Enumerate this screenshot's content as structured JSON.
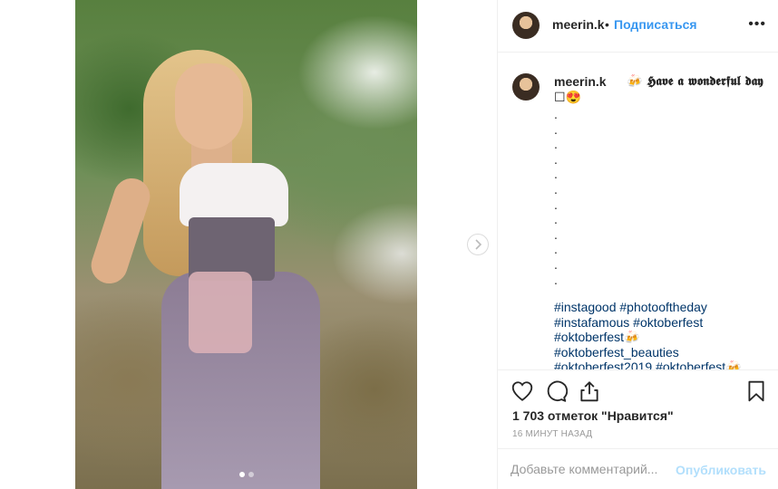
{
  "post": {
    "username": "meerin.k",
    "follow_label": "Подписаться",
    "separator": "•",
    "more_label": "•••",
    "caption_emoji": "🍻",
    "caption_text": "𝕳𝖆𝖛𝖊 𝖆 𝖜𝖔𝖓𝖉𝖊𝖗𝖋𝖚𝖑 𝖉𝖆𝖞",
    "caption_line2": "☐😍",
    "dot_lines": ".\n.\n.\n.\n.\n.\n.\n.\n.\n.\n.\n.",
    "hashtags": [
      "#instagood #photooftheday",
      "#instafamous #oktoberfest",
      "#oktoberfest🍻",
      "#oktoberfest_beauties",
      "#oktoberfest2019 #oktoberfest🍻"
    ],
    "likes_text": "1 703 отметок \"Нравится\"",
    "time_text": "16 МИНУТ НАЗАД",
    "comment_placeholder": "Добавьте комментарий...",
    "publish_label": "Опубликовать"
  },
  "carousel": {
    "slide_count": 2,
    "active_index": 0
  },
  "icons": {
    "like": "heart-icon",
    "comment": "comment-icon",
    "share": "share-icon",
    "save": "bookmark-icon",
    "next": "chevron-right-icon"
  },
  "colors": {
    "link": "#3897f0",
    "hashtag": "#003569",
    "muted": "#999999",
    "publish_disabled": "#b2dffc"
  }
}
